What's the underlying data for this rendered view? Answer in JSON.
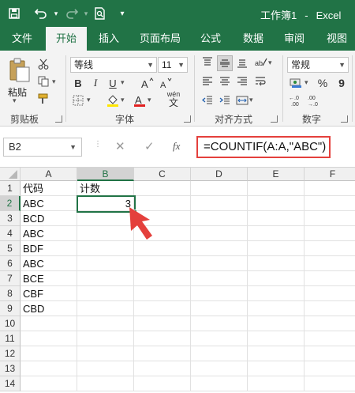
{
  "window": {
    "workbook_name": "工作簿1",
    "separator": "-",
    "app_name": "Excel"
  },
  "quick_access": {
    "save_icon": "save-icon",
    "undo_icon": "undo-icon",
    "redo_icon": "redo-icon",
    "preview_icon": "print-preview-icon",
    "customize_icon": "customize-qat-icon"
  },
  "tabs": [
    {
      "label": "文件",
      "active": false
    },
    {
      "label": "开始",
      "active": true
    },
    {
      "label": "插入",
      "active": false
    },
    {
      "label": "页面布局",
      "active": false
    },
    {
      "label": "公式",
      "active": false
    },
    {
      "label": "数据",
      "active": false
    },
    {
      "label": "审阅",
      "active": false
    },
    {
      "label": "视图",
      "active": false
    }
  ],
  "ribbon": {
    "clipboard": {
      "paste_label": "粘贴",
      "group_label": "剪贴板"
    },
    "font": {
      "font_name": "等线",
      "font_size": "11",
      "bold": "B",
      "italic": "I",
      "underline": "U",
      "font_color_letter": "A",
      "phonetic": "wén",
      "group_label": "字体"
    },
    "alignment": {
      "group_label": "对齐方式"
    },
    "number": {
      "format": "常规",
      "percent": "%",
      "comma": "9",
      "group_label": "数字"
    }
  },
  "formula_bar": {
    "name_box": "B2",
    "cancel": "✕",
    "enter": "✓",
    "fx": "fx",
    "formula": "=COUNTIF(A:A,\"ABC\")"
  },
  "sheet": {
    "columns": [
      "A",
      "B",
      "C",
      "D",
      "E",
      "F"
    ],
    "selected_column": "B",
    "rows": [
      "1",
      "2",
      "3",
      "4",
      "5",
      "6",
      "7",
      "8",
      "9",
      "10",
      "11",
      "12",
      "13",
      "14"
    ],
    "selected_row": "2",
    "cells": {
      "A1": "代码",
      "B1": "计数",
      "A2": "ABC",
      "B2": "3",
      "A3": "BCD",
      "A4": "ABC",
      "A5": "BDF",
      "A6": "ABC",
      "A7": "BCE",
      "A8": "CBF",
      "A9": "CBD"
    }
  },
  "colors": {
    "brand": "#217346",
    "highlight_box": "#e4403c",
    "arrow": "#e4403c"
  }
}
